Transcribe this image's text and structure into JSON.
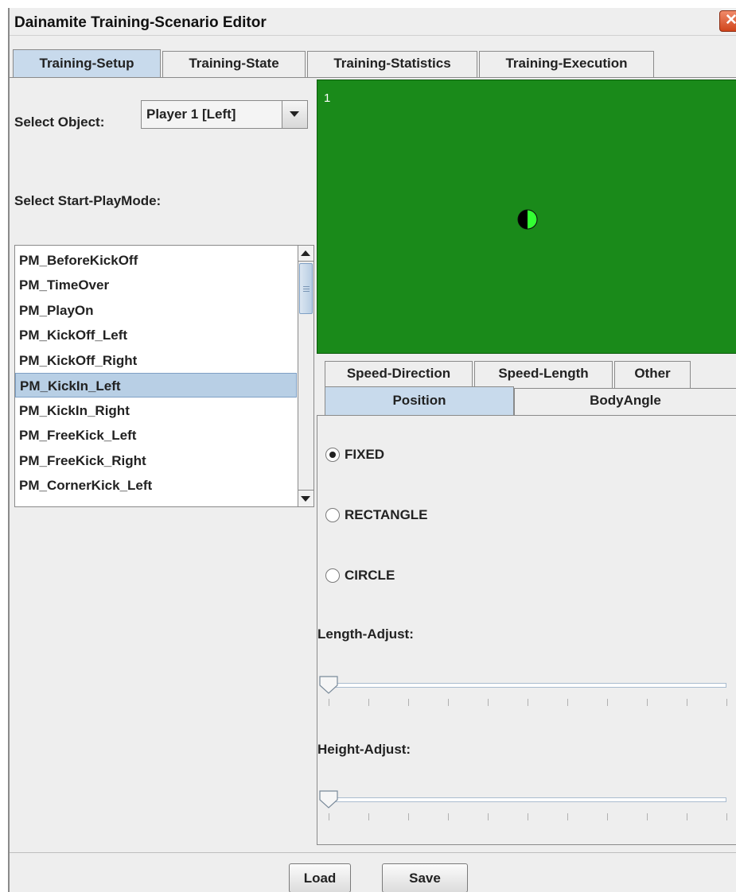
{
  "window": {
    "title": "Dainamite Training-Scenario Editor",
    "close_glyph": "✕"
  },
  "main_tabs": [
    {
      "label": "Training-Setup",
      "selected": true
    },
    {
      "label": "Training-State",
      "selected": false
    },
    {
      "label": "Training-Statistics",
      "selected": false
    },
    {
      "label": "Training-Execution",
      "selected": false
    }
  ],
  "setup": {
    "select_object_label": "Select Object:",
    "object_value": "Player 1 [Left]",
    "start_playmode_label": "Select Start-PlayMode:",
    "playmodes": [
      "PM_BeforeKickOff",
      "PM_TimeOver",
      "PM_PlayOn",
      "PM_KickOff_Left",
      "PM_KickOff_Right",
      "PM_KickIn_Left",
      "PM_KickIn_Right",
      "PM_FreeKick_Left",
      "PM_FreeKick_Right",
      "PM_CornerKick_Left"
    ],
    "selected_playmode": "PM_KickIn_Left"
  },
  "field": {
    "background_color": "#1a8a1a",
    "player_number": "1",
    "player_color_left": "#000000",
    "player_color_right": "#33ff33"
  },
  "sub_tabs": {
    "row_back": [
      {
        "label": "Speed-Direction",
        "selected": false
      },
      {
        "label": "Speed-Length",
        "selected": false
      },
      {
        "label": "Other",
        "selected": false
      }
    ],
    "row_front": [
      {
        "label": "Position",
        "selected": true
      },
      {
        "label": "BodyAngle",
        "selected": false
      }
    ]
  },
  "position": {
    "radios": [
      {
        "label": "FIXED",
        "checked": true
      },
      {
        "label": "RECTANGLE",
        "checked": false
      },
      {
        "label": "CIRCLE",
        "checked": false
      }
    ],
    "length_adjust_label": "Length-Adjust:",
    "length_adjust_value": 0,
    "height_adjust_label": "Height-Adjust:",
    "height_adjust_value": 0
  },
  "buttons": {
    "load_label": "Load",
    "save_label": "Save"
  },
  "colors": {
    "selection": "#b8cfe5",
    "selected_tab": "#c8daec",
    "close_button": "#d0451b"
  }
}
